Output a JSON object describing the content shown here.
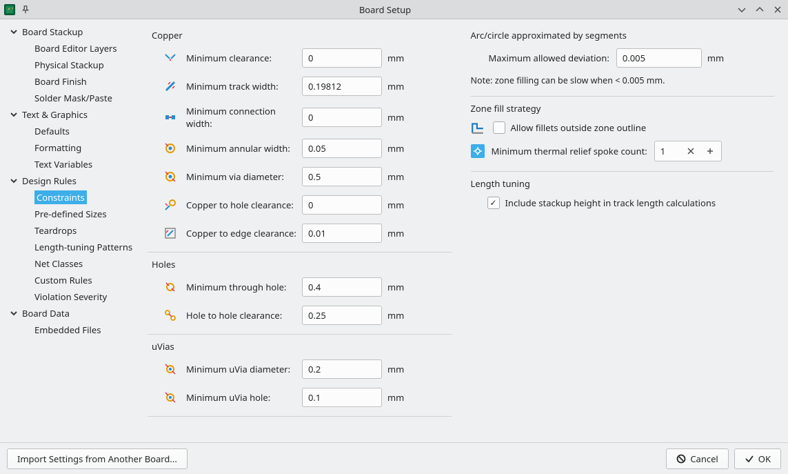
{
  "window": {
    "title": "Board Setup"
  },
  "sidebar": {
    "groups": [
      {
        "label": "Board Stackup",
        "items": [
          "Board Editor Layers",
          "Physical Stackup",
          "Board Finish",
          "Solder Mask/Paste"
        ]
      },
      {
        "label": "Text & Graphics",
        "items": [
          "Defaults",
          "Formatting",
          "Text Variables"
        ]
      },
      {
        "label": "Design Rules",
        "items": [
          "Constraints",
          "Pre-defined Sizes",
          "Teardrops",
          "Length-tuning Patterns",
          "Net Classes",
          "Custom Rules",
          "Violation Severity"
        ]
      },
      {
        "label": "Board Data",
        "items": [
          "Embedded Files"
        ]
      }
    ],
    "selected": "Constraints"
  },
  "left": {
    "sections": {
      "copper": {
        "title": "Copper",
        "rows": [
          {
            "label": "Minimum clearance:",
            "value": "0",
            "unit": "mm"
          },
          {
            "label": "Minimum track width:",
            "value": "0.19812",
            "unit": "mm"
          },
          {
            "label": "Minimum connection width:",
            "value": "0",
            "unit": "mm"
          },
          {
            "label": "Minimum annular width:",
            "value": "0.05",
            "unit": "mm"
          },
          {
            "label": "Minimum via diameter:",
            "value": "0.5",
            "unit": "mm"
          },
          {
            "label": "Copper to hole clearance:",
            "value": "0",
            "unit": "mm"
          },
          {
            "label": "Copper to edge clearance:",
            "value": "0.01",
            "unit": "mm"
          }
        ]
      },
      "holes": {
        "title": "Holes",
        "rows": [
          {
            "label": "Minimum through hole:",
            "value": "0.4",
            "unit": "mm"
          },
          {
            "label": "Hole to hole clearance:",
            "value": "0.25",
            "unit": "mm"
          }
        ]
      },
      "uvias": {
        "title": "uVias",
        "rows": [
          {
            "label": "Minimum uVia diameter:",
            "value": "0.2",
            "unit": "mm"
          },
          {
            "label": "Minimum uVia hole:",
            "value": "0.1",
            "unit": "mm"
          }
        ]
      }
    }
  },
  "right": {
    "arc": {
      "title": "Arc/circle approximated by segments",
      "dev_label": "Maximum allowed deviation:",
      "dev_value": "0.005",
      "dev_unit": "mm",
      "note": "Note: zone filling can be slow when < 0.005 mm."
    },
    "zone": {
      "title": "Zone fill strategy",
      "fillets_label": "Allow fillets outside zone outline",
      "fillets_checked": false,
      "spoke_label": "Minimum thermal relief spoke count:",
      "spoke_value": "1"
    },
    "length": {
      "title": "Length tuning",
      "stackup_label": "Include stackup height in track length calculations",
      "stackup_checked": true
    }
  },
  "footer": {
    "import_label": "Import Settings from Another Board...",
    "cancel_label": "Cancel",
    "ok_label": "OK"
  }
}
